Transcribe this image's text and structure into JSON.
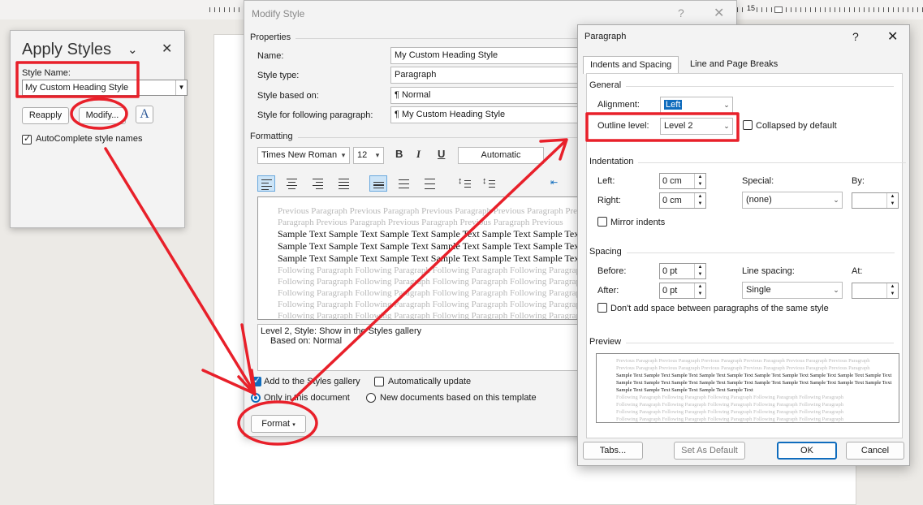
{
  "ruler": {
    "number": "15"
  },
  "apply_styles": {
    "title": "Apply Styles",
    "style_name_label": "Style Name:",
    "style_name_value": "My Custom Heading Style",
    "reapply": "Reapply",
    "modify": "Modify...",
    "autocomplete": "AutoComplete style names",
    "autocomplete_checked": true
  },
  "modify_style": {
    "title": "Modify Style",
    "help": "?",
    "properties": "Properties",
    "name_label": "Name:",
    "name_value": "My Custom Heading Style",
    "type_label": "Style type:",
    "type_value": "Paragraph",
    "based_label": "Style based on:",
    "based_value": "¶  Normal",
    "following_label": "Style for following paragraph:",
    "following_value": "¶  My Custom Heading Style",
    "formatting": "Formatting",
    "font": "Times New Roman",
    "size": "12",
    "bold": "B",
    "italic": "I",
    "underline": "U",
    "color": "Automatic",
    "preview_prev": "Previous Paragraph Previous Paragraph Previous Paragraph Previous Paragraph Previous",
    "preview_prev2": "Paragraph Previous Paragraph Previous Paragraph Previous Paragraph Previous",
    "preview_sample": "Sample Text Sample Text Sample Text Sample Text Sample Text Sample Text Sample",
    "preview_follow": "Following Paragraph Following Paragraph Following Paragraph Following Paragraph",
    "description_line1": "Level 2, Style: Show in the Styles gallery",
    "description_line2": "Based on: Normal",
    "add_gallery": "Add to the Styles gallery",
    "auto_update": "Automatically update",
    "only_doc": "Only in this document",
    "new_docs": "New documents based on this template",
    "format_button": "Format"
  },
  "paragraph": {
    "title": "Paragraph",
    "help": "?",
    "tab_indents": "Indents and Spacing",
    "tab_breaks": "Line and Page Breaks",
    "general": "General",
    "alignment_label": "Alignment:",
    "alignment_value": "Left",
    "outline_label": "Outline level:",
    "outline_value": "Level 2",
    "collapsed": "Collapsed by default",
    "indentation": "Indentation",
    "left_label": "Left:",
    "left_value": "0 cm",
    "right_label": "Right:",
    "right_value": "0 cm",
    "special_label": "Special:",
    "special_value": "(none)",
    "by_label": "By:",
    "mirror": "Mirror indents",
    "spacing": "Spacing",
    "before_label": "Before:",
    "before_value": "0 pt",
    "after_label": "After:",
    "after_value": "0 pt",
    "line_spacing_label": "Line spacing:",
    "line_spacing_value": "Single",
    "at_label": "At:",
    "dont_add": "Don't add space between paragraphs of the same style",
    "preview": "Preview",
    "prev_gray": "Previous Paragraph Previous Paragraph Previous Paragraph Previous Paragraph Previous Paragraph Previous Paragraph",
    "prev_sample": "Sample Text Sample Text Sample Text Sample Text Sample Text Sample Text Sample Text Sample Text Sample Text Sample Text",
    "prev_sample_short": "Sample Text Sample Text Sample Text Sample Text Sample Text",
    "prev_follow": "Following Paragraph Following Paragraph Following Paragraph Following Paragraph Following Paragraph",
    "tabs_button": "Tabs...",
    "default_button": "Set As Default",
    "ok_button": "OK",
    "cancel_button": "Cancel"
  },
  "colors": {
    "annotation": "#e8202a",
    "accent": "#0f6cbd"
  }
}
